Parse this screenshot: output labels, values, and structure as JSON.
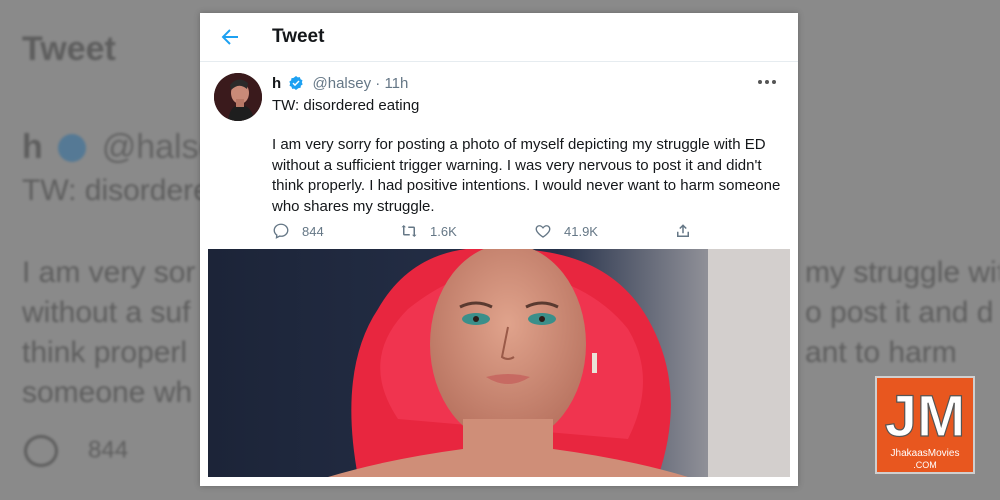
{
  "header": {
    "title": "Tweet"
  },
  "tweet": {
    "display_name": "h",
    "handle": "@halsey",
    "separator": "·",
    "time": "11h",
    "warning": "TW: disordered eating",
    "body": "I am very sorry for posting a photo of myself depicting my struggle with ED without a sufficient trigger warning. I was very nervous to post it and didn't think properly. I had positive intentions. I would never want to harm someone who shares my struggle.",
    "replies": "844",
    "retweets": "1.6K",
    "likes": "41.9K"
  },
  "background": {
    "title": "Tweet",
    "name": "h",
    "handle": "@halsey",
    "warning": "TW: disordere",
    "line1": "I am very sor",
    "line1_right": "my struggle wit",
    "line2": "without a suf",
    "line2_right": "o post it and d",
    "line3": "think properl",
    "line3_right": "ant to harm",
    "line4": "someone wh",
    "replies": "844"
  },
  "watermark": {
    "initials": "JM",
    "site": "JhakaasMovies",
    "domain": ".COM"
  },
  "icons": {
    "back": "arrow-left-icon",
    "verified": "verified-badge-icon",
    "more": "more-horizontal-icon",
    "reply": "reply-icon",
    "retweet": "retweet-icon",
    "like": "heart-icon",
    "share": "share-icon"
  },
  "colors": {
    "accent": "#1da1f2",
    "text": "#14171a",
    "muted": "#657786",
    "logo": "#e8571f"
  }
}
